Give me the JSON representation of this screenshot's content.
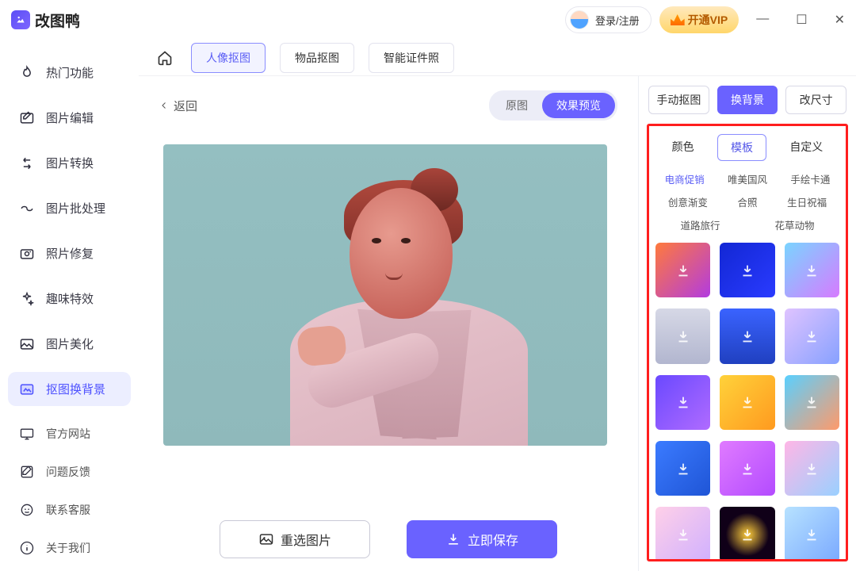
{
  "titlebar": {
    "app_name": "改图鸭",
    "login_label": "登录/注册",
    "vip_label": "开通VIP"
  },
  "sidebar": {
    "items": [
      {
        "label": "热门功能",
        "icon": "flame-icon"
      },
      {
        "label": "图片编辑",
        "icon": "edit-image-icon"
      },
      {
        "label": "图片转换",
        "icon": "convert-icon"
      },
      {
        "label": "图片批处理",
        "icon": "batch-icon"
      },
      {
        "label": "照片修复",
        "icon": "repair-icon"
      },
      {
        "label": "趣味特效",
        "icon": "sparkle-icon"
      },
      {
        "label": "图片美化",
        "icon": "beautify-icon"
      },
      {
        "label": "抠图换背景",
        "icon": "bg-swap-icon"
      }
    ],
    "active_index": 7,
    "footer": [
      {
        "label": "官方网站",
        "icon": "monitor-icon"
      },
      {
        "label": "问题反馈",
        "icon": "feedback-icon"
      },
      {
        "label": "联系客服",
        "icon": "support-icon"
      },
      {
        "label": "关于我们",
        "icon": "info-icon"
      }
    ]
  },
  "tabs": {
    "items": [
      {
        "label": "人像抠图"
      },
      {
        "label": "物品抠图"
      },
      {
        "label": "智能证件照"
      }
    ],
    "active_index": 0
  },
  "canvas_header": {
    "back_label": "返回",
    "seg_original": "原图",
    "seg_preview": "效果预览"
  },
  "buttons": {
    "reselect": "重选图片",
    "save": "立即保存"
  },
  "right": {
    "ops": [
      {
        "label": "手动抠图"
      },
      {
        "label": "换背景"
      },
      {
        "label": "改尺寸"
      }
    ],
    "ops_active": 1,
    "subopts": [
      "颜色",
      "模板",
      "自定义"
    ],
    "subopt_active": 1,
    "categories": [
      "电商促销",
      "唯美国风",
      "手绘卡通",
      "创意渐变",
      "合照",
      "生日祝福",
      "道路旅行",
      "花草动物"
    ],
    "cat_active": 0,
    "thumb_styles": [
      "linear-gradient(135deg,#ff7a3c,#b23be0)",
      "linear-gradient(135deg,#1227d4,#2a3bff)",
      "linear-gradient(135deg,#7ad4ff,#d67bff)",
      "linear-gradient(180deg,#d6d8e6,#b2b6cf)",
      "linear-gradient(180deg,#3a63ff,#2040c0)",
      "linear-gradient(135deg,#dfc3ff,#87a1ff)",
      "linear-gradient(135deg,#6a49ff,#b06bff)",
      "linear-gradient(135deg,#ffd23a,#ff9a1f)",
      "linear-gradient(135deg,#5ad0ff,#ff9a6a)",
      "linear-gradient(135deg,#3b7bff,#1f55d6)",
      "linear-gradient(135deg,#e07bff,#b34bff)",
      "linear-gradient(135deg,#ffb6e6,#9ad0ff)",
      "linear-gradient(135deg,#ffd0e8,#d0b0ff)",
      "radial-gradient(circle at 50% 50%,#ffce3a,#100018 55%)",
      "linear-gradient(135deg,#b7e2ff,#7aa9ff)"
    ]
  }
}
